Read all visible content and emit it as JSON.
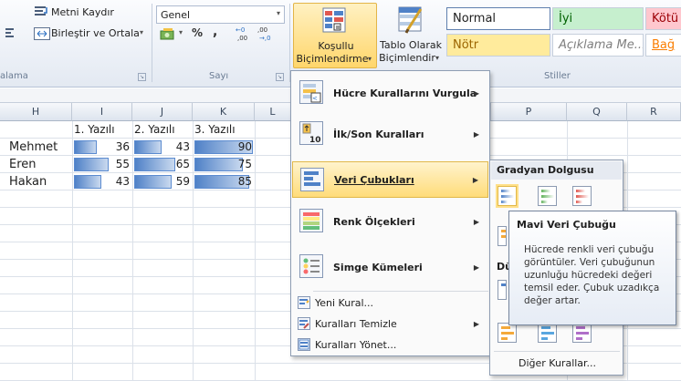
{
  "ribbon": {
    "alignment": {
      "wrap_text": "Metni Kaydır",
      "merge_center": "Birleştir ve Ortala",
      "group_label": "alama"
    },
    "number": {
      "format_value": "Genel",
      "percent": "%",
      "comma": ",",
      "group_label": "Sayı"
    },
    "styles": {
      "conditional_formatting": [
        "Koşullu",
        "Biçimlendirme"
      ],
      "format_as_table": [
        "Tablo Olarak",
        "Biçimlendir"
      ],
      "cells": [
        {
          "label": "Normal",
          "bg": "#ffffff",
          "fg": "#1e1e1e"
        },
        {
          "label": "İyi",
          "bg": "#c6efce",
          "fg": "#006100"
        },
        {
          "label": "Kötü",
          "bg": "#ffc7ce",
          "fg": "#9c0006"
        },
        {
          "label": "Nötr",
          "bg": "#ffeb9c",
          "fg": "#9c6500"
        },
        {
          "label": "Açıklama Me...",
          "bg": "#ffffff",
          "fg": "#7f7f7f"
        },
        {
          "label": "Bağ",
          "bg": "#ffffff",
          "fg": "#fa7d00"
        }
      ],
      "group_label": "Stiller"
    }
  },
  "grid": {
    "columns": [
      "H",
      "I",
      "J",
      "K",
      "L",
      "P",
      "Q",
      "R"
    ],
    "headers": [
      "1. Yazılı",
      "2. Yazılı",
      "3. Yazılı"
    ],
    "rows": [
      {
        "name": "Mehmet",
        "values": [
          36,
          43,
          90
        ]
      },
      {
        "name": "Eren",
        "values": [
          55,
          65,
          75
        ]
      },
      {
        "name": "Hakan",
        "values": [
          43,
          59,
          85
        ]
      }
    ],
    "max_value": 90
  },
  "menu": {
    "items": [
      {
        "label": "Hücre Kurallarını Vurgula",
        "submenu": true
      },
      {
        "label": "İlk/Son Kuralları",
        "submenu": true
      },
      {
        "label": "Veri Çubukları",
        "submenu": true
      },
      {
        "label": "Renk Ölçekleri",
        "submenu": true
      },
      {
        "label": "Simge Kümeleri",
        "submenu": true
      },
      {
        "label": "Yeni Kural...",
        "submenu": false
      },
      {
        "label": "Kuralları Temizle",
        "submenu": true
      },
      {
        "label": "Kuralları Yönet...",
        "submenu": false
      }
    ],
    "icon_digit": "10"
  },
  "submenu": {
    "gradient_header": "Gradyan Dolgusu",
    "solid_header_partial": "Dü",
    "more_rules": "Diğer Kurallar...",
    "bar_colors": [
      "#4f81c7",
      "#63b35d",
      "#e0584f",
      "#f4a93b",
      "#59a6e0",
      "#b06fc9"
    ]
  },
  "tooltip": {
    "title": "Mavi Veri Çubuğu",
    "body": "Hücrede renkli veri çubuğu görüntüler. Veri çubuğunun uzunluğu hücredeki değeri temsil eder. Çubuk uzadıkça değer artar."
  }
}
